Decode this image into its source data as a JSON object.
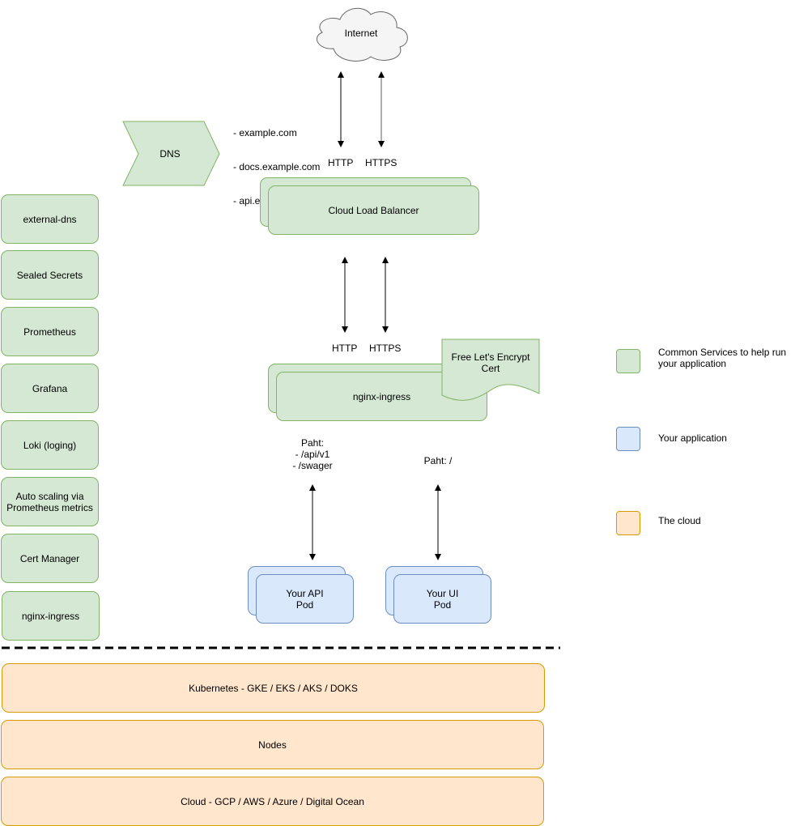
{
  "internet": {
    "label": "Internet"
  },
  "dns": {
    "label": "DNS",
    "domains": [
      "- example.com",
      "- docs.example.com",
      "- api.example.com"
    ]
  },
  "load_balancer": {
    "label": "Cloud Load Balancer",
    "protocols": [
      "HTTP",
      "HTTPS"
    ]
  },
  "ingress": {
    "label": "nginx-ingress",
    "protocols": [
      "HTTP",
      "HTTPS"
    ],
    "cert_label": "Free Let's Encrypt\nCert"
  },
  "routes": {
    "api": "Paht:\n- /api/v1\n- /swager",
    "ui": "Paht: /"
  },
  "pods": {
    "api": "Your API\nPod",
    "ui": "Your UI\nPod"
  },
  "common_services": [
    "external-dns",
    "Sealed Secrets",
    "Prometheus",
    "Grafana",
    "Loki (loging)",
    "Auto scaling via\nPrometheus metrics",
    "Cert Manager",
    "nginx-ingress"
  ],
  "infrastructure": [
    "Kubernetes - GKE / EKS / AKS / DOKS",
    "Nodes",
    "Cloud - GCP / AWS / Azure / Digital Ocean"
  ],
  "legend": [
    {
      "label": "Common Services to help run\nyour application",
      "color": "#d5e8d4",
      "border": "#82b366"
    },
    {
      "label": "Your application",
      "color": "#dae8fc",
      "border": "#6c8ebf"
    },
    {
      "label": "The cloud",
      "color": "#ffe6cc",
      "border": "#d79b00"
    }
  ],
  "colors": {
    "green_fill": "#d5e8d4",
    "green_stroke": "#82b366",
    "blue_fill": "#dae8fc",
    "blue_stroke": "#6c8ebf",
    "orange_fill": "#ffe6cc",
    "orange_stroke": "#d79b00",
    "cloud_fill": "#f5f5f5",
    "cloud_stroke": "#666666"
  }
}
